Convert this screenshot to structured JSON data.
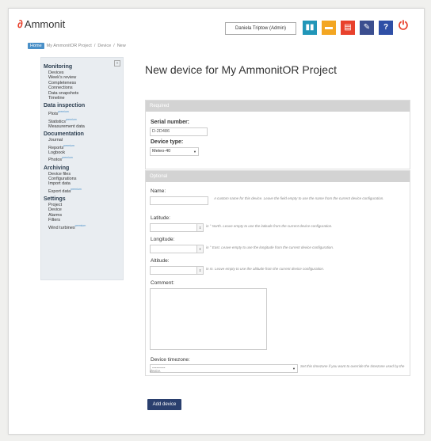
{
  "app": {
    "name": "Ammonit"
  },
  "header": {
    "user": "Daniela Triptow (Admin)",
    "icons": [
      {
        "name": "stats-icon",
        "glyph": "▮▮"
      },
      {
        "name": "folder-icon",
        "glyph": "▬"
      },
      {
        "name": "book-icon",
        "glyph": "▤"
      },
      {
        "name": "edit-icon",
        "glyph": "✎"
      },
      {
        "name": "help-icon",
        "glyph": "?"
      }
    ],
    "logout_glyph": "⏻"
  },
  "breadcrumb": {
    "home": "Home",
    "project": "My AmmonitOR Project",
    "sep": "/",
    "device": "Device",
    "new": "New"
  },
  "sidebar": {
    "sections": [
      {
        "title": "Monitoring",
        "items": [
          {
            "label": "Devices"
          },
          {
            "label": "Week's review"
          },
          {
            "label": "Completeness"
          },
          {
            "label": "Connections"
          },
          {
            "label": "Data snapshots"
          },
          {
            "label": "Timeline"
          }
        ]
      },
      {
        "title": "Data inspection",
        "items": [
          {
            "label": "Plots",
            "badge": "premium"
          },
          {
            "label": "Statistics",
            "badge": "premium"
          },
          {
            "label": "Measurement data"
          }
        ]
      },
      {
        "title": "Documentation",
        "items": [
          {
            "label": "Journal"
          },
          {
            "label": "Reports",
            "badge": "premium"
          },
          {
            "label": "Logbook"
          },
          {
            "label": "Photos",
            "badge": "premium"
          }
        ]
      },
      {
        "title": "Archiving",
        "items": [
          {
            "label": "Device files"
          },
          {
            "label": "Configurations"
          },
          {
            "label": "Import data"
          },
          {
            "label": "Export data",
            "badge": "premium"
          }
        ]
      },
      {
        "title": "Settings",
        "items": [
          {
            "label": "Project"
          },
          {
            "label": "Device"
          },
          {
            "label": "Alarms"
          },
          {
            "label": "Filters"
          },
          {
            "label": "Wind turbines",
            "badge": "premium"
          }
        ]
      }
    ]
  },
  "page": {
    "title": "New device for My AmmonitOR Project"
  },
  "required": {
    "heading": "Required",
    "serial_label": "Serial number:",
    "serial_value": "D-2D486",
    "type_label": "Device type:",
    "type_value": "Meteo-40"
  },
  "optional": {
    "heading": "Optional",
    "name_label": "Name:",
    "name_help": "A custom name for this device. Leave the field empty to use the name from the current device configuration.",
    "lat_label": "Latitude:",
    "lat_help": "in ° North. Leave empty to use the latitude from the current device configuration.",
    "lon_label": "Longitude:",
    "lon_help": "in ° East. Leave empty to use the longitude from the current device configuration.",
    "alt_label": "Altitude:",
    "alt_help": "in m. Leave empty to use the altitude from the current device configuration.",
    "comment_label": "Comment:",
    "tz_label": "Device timezone:",
    "tz_value": "---------",
    "tz_help": "Set this timezone if you want to override the timezone used by the device."
  },
  "submit": {
    "label": "Add device"
  }
}
